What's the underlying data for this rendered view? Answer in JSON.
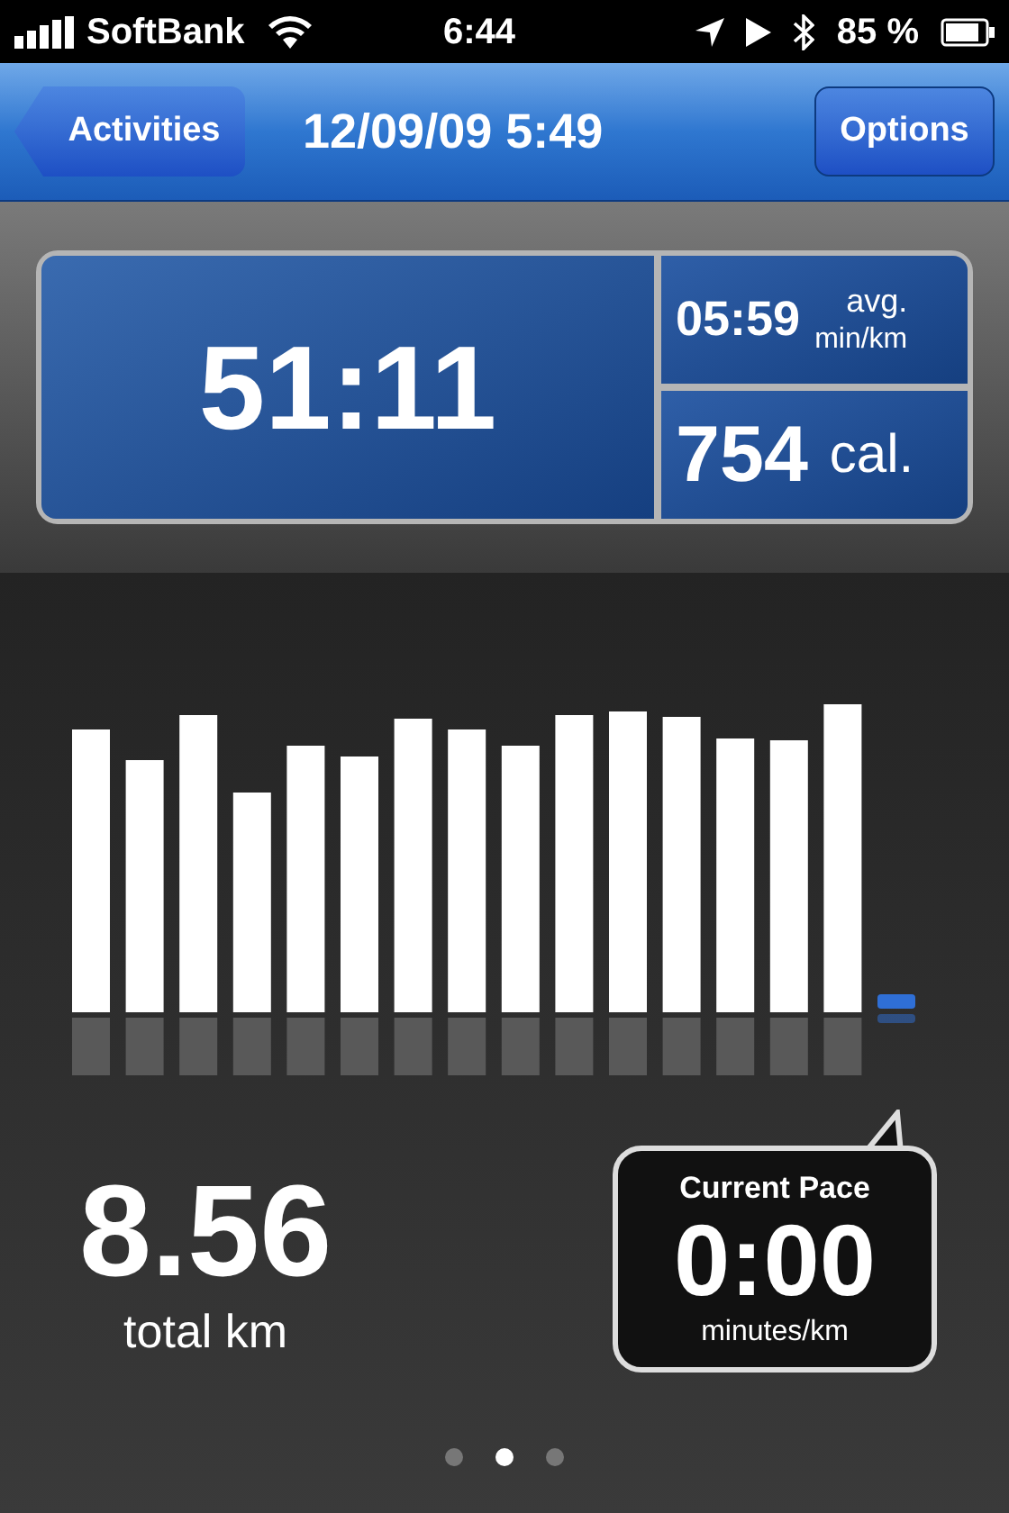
{
  "status_bar": {
    "carrier": "SoftBank",
    "time": "6:44",
    "battery": "85 %"
  },
  "nav_bar": {
    "back_button": "Activities",
    "title": "12/09/09 5:49",
    "right_button": "Options"
  },
  "stats": {
    "duration": "51:11",
    "pace": {
      "value": "05:59",
      "unit_top": "avg.",
      "unit_bottom": "min/km"
    },
    "calories": {
      "value": "754",
      "unit": "cal."
    }
  },
  "distance": {
    "value": "8.56",
    "label": "total km"
  },
  "current_pace": {
    "title": "Current Pace",
    "value": "0:00",
    "unit": "minutes/km"
  },
  "page_dots": [
    {
      "selected": false
    },
    {
      "selected": true
    },
    {
      "selected": false
    }
  ]
}
